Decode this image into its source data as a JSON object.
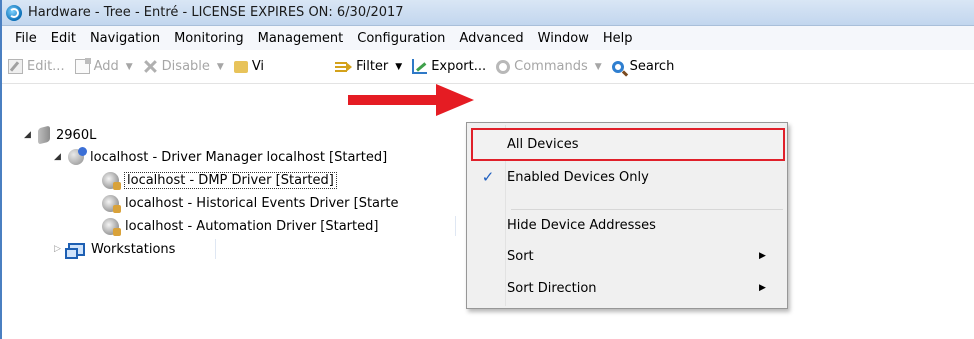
{
  "window": {
    "title": "Hardware - Tree - Entré - LICENSE EXPIRES ON: 6/30/2017"
  },
  "menubar": {
    "items": [
      "File",
      "Edit",
      "Navigation",
      "Monitoring",
      "Management",
      "Configuration",
      "Advanced",
      "Window",
      "Help"
    ]
  },
  "toolbar": {
    "edit": "Edit...",
    "add": "Add",
    "disable": "Disable",
    "view": "Vi",
    "filter": "Filter",
    "export": "Export...",
    "commands": "Commands",
    "search": "Search",
    "dropdown_glyph": "▼"
  },
  "tree": {
    "expanded_glyph": "◢",
    "collapsed_glyph": "▷",
    "root": "2960L",
    "manager": "localhost - Driver Manager localhost [Started]",
    "drivers": [
      "localhost - DMP Driver [Started]",
      "localhost - Historical Events Driver [Starte",
      "localhost - Automation Driver [Started]"
    ],
    "workstations": "Workstations"
  },
  "filter_menu": {
    "check_glyph": "✓",
    "submenu_glyph": "▶",
    "items": [
      {
        "label": "All Devices",
        "checked": false,
        "submenu": false,
        "highlighted": true
      },
      {
        "label": "Enabled Devices Only",
        "checked": true,
        "submenu": false
      },
      {
        "label": "Hide Device Addresses",
        "checked": false,
        "submenu": false
      },
      {
        "label": "Sort",
        "checked": false,
        "submenu": true
      },
      {
        "label": "Sort Direction",
        "checked": false,
        "submenu": true
      }
    ]
  },
  "annotation": {
    "arrow_color": "#e51c23",
    "highlight_color": "#e0202a"
  }
}
